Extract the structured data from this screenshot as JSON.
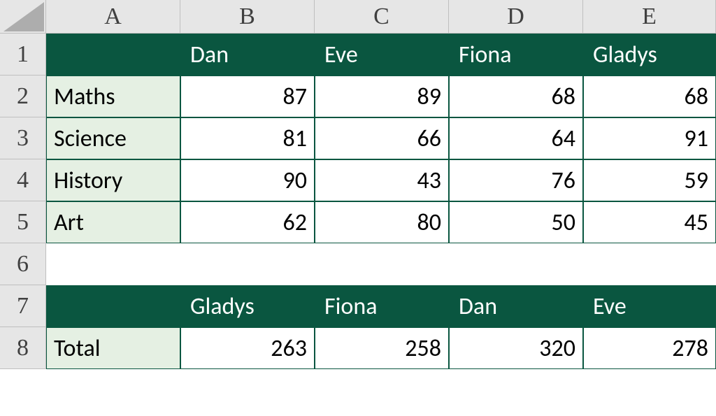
{
  "columns": [
    "A",
    "B",
    "C",
    "D",
    "E"
  ],
  "rows": [
    "1",
    "2",
    "3",
    "4",
    "5",
    "6",
    "7",
    "8"
  ],
  "table1": {
    "headers": [
      "Dan",
      "Eve",
      "Fiona",
      "Gladys"
    ],
    "subjects": [
      "Maths",
      "Science",
      "History",
      "Art"
    ],
    "data": {
      "maths": [
        87,
        89,
        68,
        68
      ],
      "science": [
        81,
        66,
        64,
        91
      ],
      "history": [
        90,
        43,
        76,
        59
      ],
      "art": [
        62,
        80,
        50,
        45
      ]
    }
  },
  "table2": {
    "headers": [
      "Gladys",
      "Fiona",
      "Dan",
      "Eve"
    ],
    "rowLabel": "Total",
    "totals": [
      263,
      258,
      320,
      278
    ]
  }
}
